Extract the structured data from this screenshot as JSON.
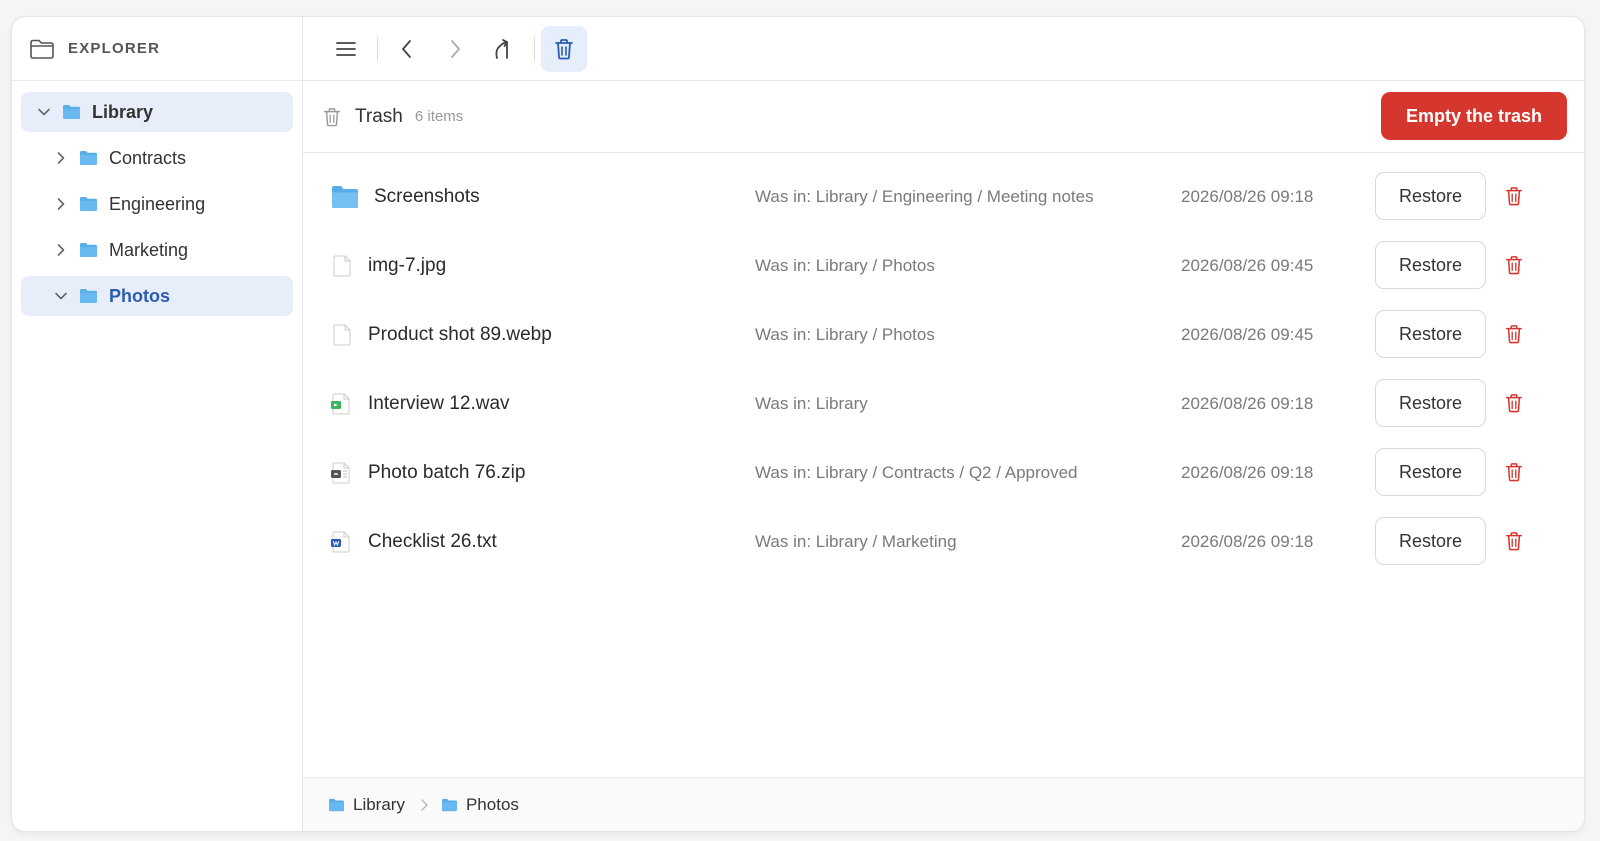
{
  "sidebar": {
    "title": "EXPLORER",
    "tree": [
      {
        "label": "Library",
        "expanded": true
      },
      {
        "label": "Contracts",
        "expanded": false
      },
      {
        "label": "Engineering",
        "expanded": false
      },
      {
        "label": "Marketing",
        "expanded": false
      },
      {
        "label": "Photos",
        "expanded": true
      }
    ]
  },
  "trash": {
    "title": "Trash",
    "count": "6 items",
    "empty_label": "Empty the trash"
  },
  "files": [
    {
      "name": "Screenshots",
      "type": "folder-icon",
      "location": "Was in: Library / Engineering / Meeting notes",
      "date": "2026/08/26 09:18",
      "restore_label": "Restore"
    },
    {
      "name": "img-7.jpg",
      "type": "file-icon",
      "location": "Was in: Library / Photos",
      "date": "2026/08/26 09:45",
      "restore_label": "Restore"
    },
    {
      "name": "Product shot 89.webp",
      "type": "file-icon",
      "location": "Was in: Library / Photos",
      "date": "2026/08/26 09:45",
      "restore_label": "Restore"
    },
    {
      "name": "Interview 12.wav",
      "type": "audio-file-icon",
      "location": "Was in: Library",
      "date": "2026/08/26 09:18",
      "restore_label": "Restore"
    },
    {
      "name": "Photo batch 76.zip",
      "type": "archive-file-icon",
      "location": "Was in: Library / Contracts / Q2 / Approved",
      "date": "2026/08/26 09:18",
      "restore_label": "Restore"
    },
    {
      "name": "Checklist 26.txt",
      "type": "word-file-icon",
      "location": "Was in: Library / Marketing",
      "date": "2026/08/26 09:18",
      "restore_label": "Restore"
    }
  ],
  "breadcrumb": [
    "Library",
    "Photos"
  ],
  "colors": {
    "accent": "#2a5db0",
    "folder": "#5aaee8",
    "danger": "#d5372f",
    "selected_bg": "#e7eefa"
  }
}
